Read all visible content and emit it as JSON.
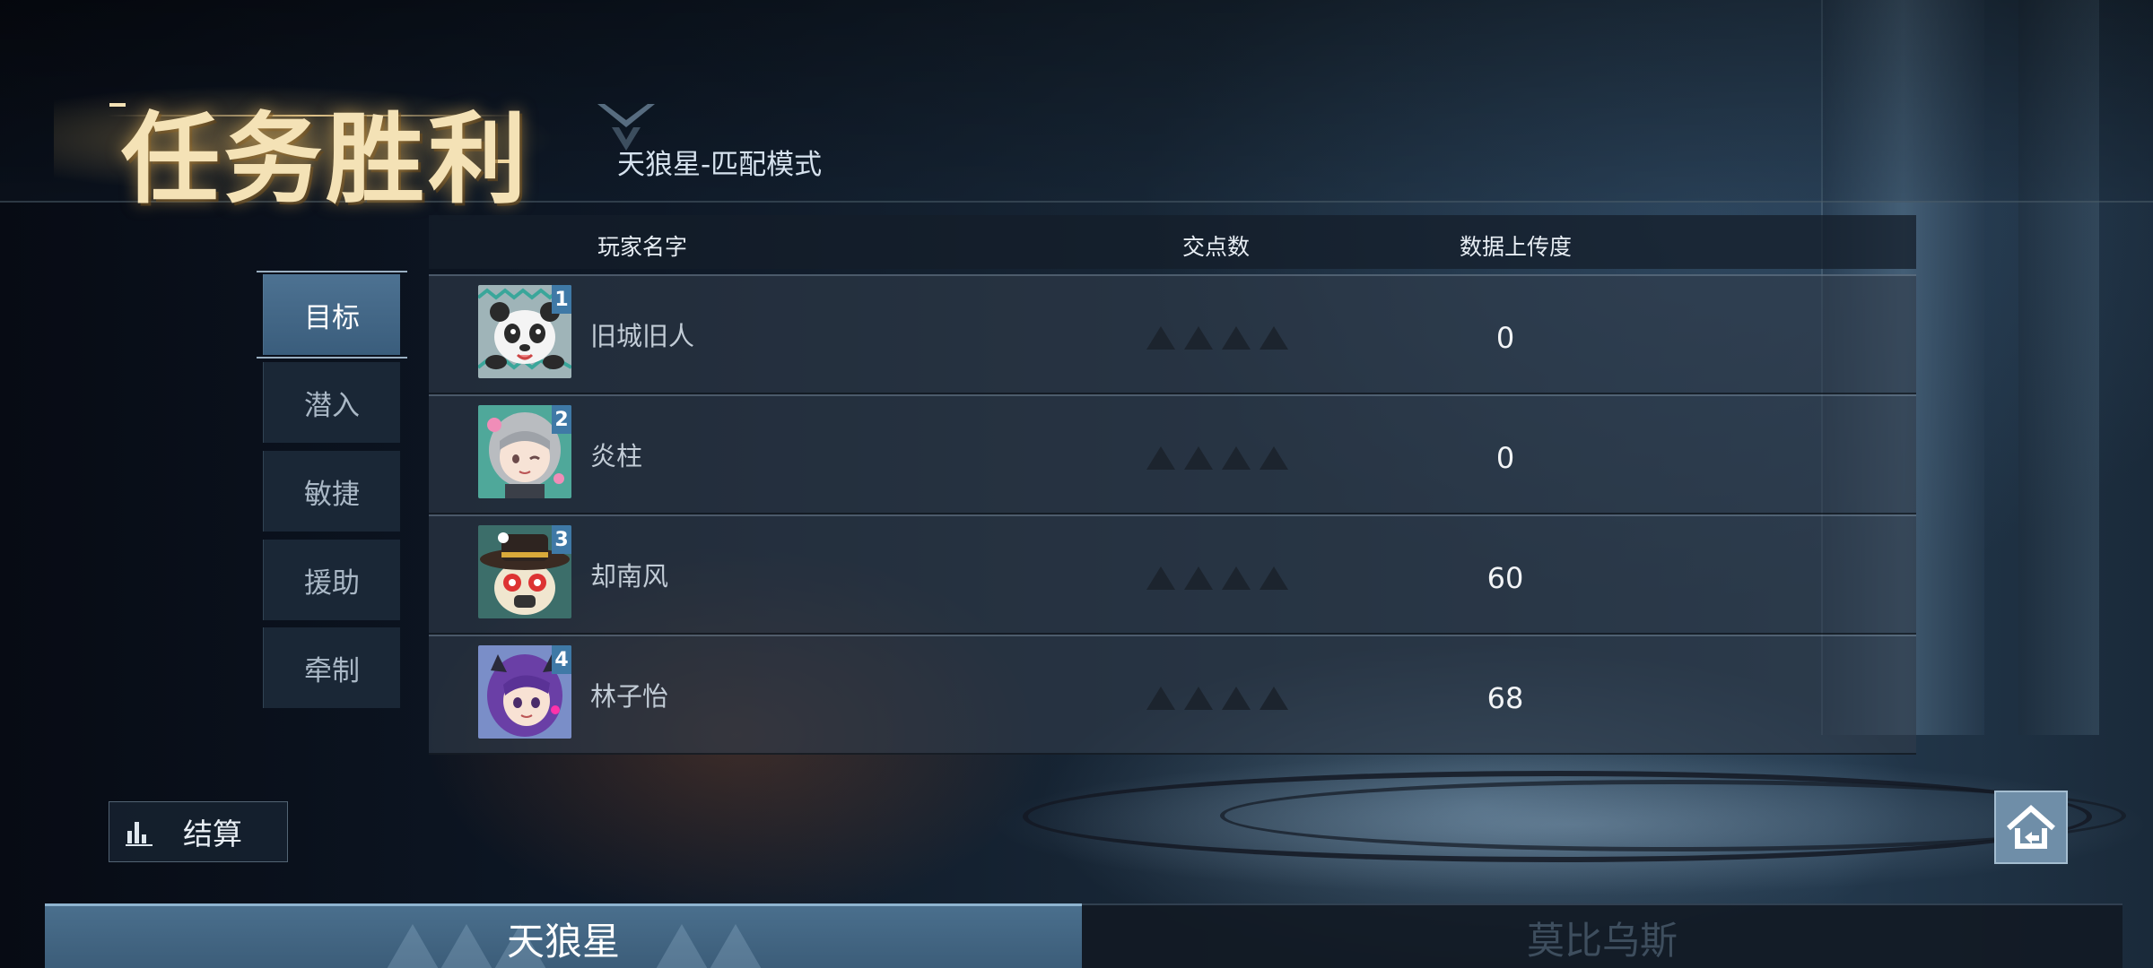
{
  "header": {
    "title": "任务胜利",
    "subtitle": "天狼星-匹配模式"
  },
  "table": {
    "columns": [
      "玩家名字",
      "交点数",
      "数据上传度"
    ]
  },
  "side_tabs": [
    {
      "label": "目标",
      "active": true
    },
    {
      "label": "潜入",
      "active": false
    },
    {
      "label": "敏捷",
      "active": false
    },
    {
      "label": "援助",
      "active": false
    },
    {
      "label": "牵制",
      "active": false
    }
  ],
  "players": [
    {
      "rank": "1",
      "name": "旧城旧人",
      "score": "0",
      "avatar": "panda-avatar"
    },
    {
      "rank": "2",
      "name": "炎柱",
      "score": "0",
      "avatar": "silver-hair-girl-avatar"
    },
    {
      "rank": "3",
      "name": "却南风",
      "score": "60",
      "avatar": "masked-hat-avatar"
    },
    {
      "rank": "4",
      "name": "林子怡",
      "score": "68",
      "avatar": "purple-hair-girl-avatar"
    }
  ],
  "buttons": {
    "settle_label": "结算"
  },
  "teams": [
    {
      "label": "天狼星",
      "active": true
    },
    {
      "label": "莫比乌斯",
      "active": false
    }
  ],
  "colors": {
    "title_gold": "#f4e2b6",
    "active_tab": "#4d7292",
    "rank_badge": "#3f79a6"
  }
}
